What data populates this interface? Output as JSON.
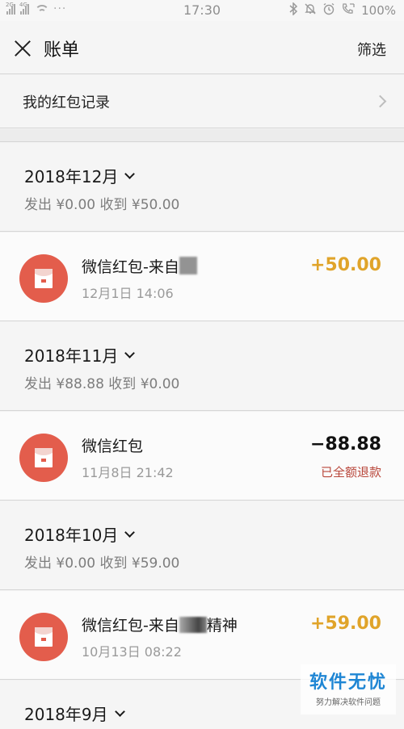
{
  "status_bar": {
    "signal1_tag": "2G",
    "signal2_tag": "4G",
    "dots": "···",
    "time": "17:30",
    "right_icons": [
      "bluetooth-icon",
      "mute-icon",
      "alarm-icon",
      "call-icon"
    ],
    "battery": "100%"
  },
  "header": {
    "title": "账单",
    "filter_label": "筛选"
  },
  "record_row": {
    "label": "我的红包记录"
  },
  "months": [
    {
      "title": "2018年12月",
      "summary": "发出 ¥0.00 收到 ¥50.00"
    },
    {
      "title": "2018年11月",
      "summary": "发出 ¥88.88 收到 ¥0.00"
    },
    {
      "title": "2018年10月",
      "summary": "发出 ¥0.00 收到 ¥59.00"
    },
    {
      "title": "2018年9月"
    }
  ],
  "transactions": [
    {
      "name": "微信红包-来自",
      "time": "12月1日 14:06",
      "amount": "+50.00",
      "amount_color": "#e0a42a"
    },
    {
      "name": "微信红包",
      "time": "11月8日 21:42",
      "amount": "−88.88",
      "amount_color": "#111111",
      "note": "已全额退款"
    },
    {
      "name": "微信红包-来自",
      "name_suffix": "精神",
      "time": "10月13日 08:22",
      "amount": "+59.00",
      "amount_color": "#e0a42a"
    }
  ],
  "watermark": {
    "title": "软件无忧",
    "subtitle": "努力解决软件问题"
  }
}
